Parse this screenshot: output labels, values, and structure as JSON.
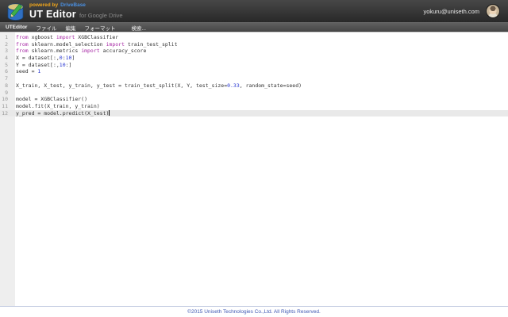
{
  "header": {
    "logo_icon": "database-pencil-icon",
    "powered_by": "powered by",
    "brand": "DriveBase",
    "app_title": "UT Editor",
    "app_subtitle": "for Google Drive",
    "user_email": "yokuru@uniseth.com"
  },
  "menu": {
    "items": [
      {
        "label": "UTEditor"
      },
      {
        "label": "ファイル"
      },
      {
        "label": "編集"
      },
      {
        "label": "フォーマット"
      },
      {
        "label": "検索..."
      }
    ]
  },
  "editor": {
    "language": "python",
    "active_line": 12,
    "lines": [
      {
        "num": 1,
        "tokens": [
          {
            "type": "keyword",
            "text": "from"
          },
          {
            "type": "plain",
            "text": " xgboost "
          },
          {
            "type": "keyword",
            "text": "import"
          },
          {
            "type": "plain",
            "text": " XGBClassifier"
          }
        ]
      },
      {
        "num": 2,
        "tokens": [
          {
            "type": "keyword",
            "text": "from"
          },
          {
            "type": "plain",
            "text": " sklearn.model_selection "
          },
          {
            "type": "keyword",
            "text": "import"
          },
          {
            "type": "plain",
            "text": " train_test_split"
          }
        ]
      },
      {
        "num": 3,
        "tokens": [
          {
            "type": "keyword",
            "text": "from"
          },
          {
            "type": "plain",
            "text": " sklearn.metrics "
          },
          {
            "type": "keyword",
            "text": "import"
          },
          {
            "type": "plain",
            "text": " accuracy_score"
          }
        ]
      },
      {
        "num": 4,
        "tokens": [
          {
            "type": "plain",
            "text": "X = dataset[:,"
          },
          {
            "type": "number",
            "text": "0"
          },
          {
            "type": "plain",
            "text": ":"
          },
          {
            "type": "number",
            "text": "10"
          },
          {
            "type": "plain",
            "text": "]"
          }
        ]
      },
      {
        "num": 5,
        "tokens": [
          {
            "type": "plain",
            "text": "Y = dataset[:,"
          },
          {
            "type": "number",
            "text": "10"
          },
          {
            "type": "plain",
            "text": ":]"
          }
        ]
      },
      {
        "num": 6,
        "tokens": [
          {
            "type": "plain",
            "text": "seed = "
          },
          {
            "type": "number",
            "text": "1"
          }
        ]
      },
      {
        "num": 7,
        "tokens": []
      },
      {
        "num": 8,
        "tokens": [
          {
            "type": "plain",
            "text": "X_train, X_test, y_train, y_test = train_test_split(X, Y, test_size="
          },
          {
            "type": "number",
            "text": "0.33"
          },
          {
            "type": "plain",
            "text": ", random_state=seed)"
          }
        ]
      },
      {
        "num": 9,
        "tokens": []
      },
      {
        "num": 10,
        "tokens": [
          {
            "type": "plain",
            "text": "model = XGBClassifier()"
          }
        ]
      },
      {
        "num": 11,
        "tokens": [
          {
            "type": "plain",
            "text": "model.fit(X_train, y_train)"
          }
        ]
      },
      {
        "num": 12,
        "tokens": [
          {
            "type": "plain",
            "text": "y_pred = model.predict(X_test)"
          }
        ]
      }
    ]
  },
  "footer": {
    "copyright": "©2015 Uniseth Technologies Co.,Ltd. All Rights Reserved."
  },
  "colors": {
    "header_top": "#474747",
    "header_bottom": "#282828",
    "powered_by": "#f2a71b",
    "brand_blue": "#4a90e2",
    "keyword": "#a626a4",
    "number": "#2433d0",
    "code_plain": "#333333",
    "line_number": "#999999",
    "active_line_bg": "#e9e9e9",
    "gutter_bg": "#eeeeee",
    "footer_text": "#4059b3"
  }
}
